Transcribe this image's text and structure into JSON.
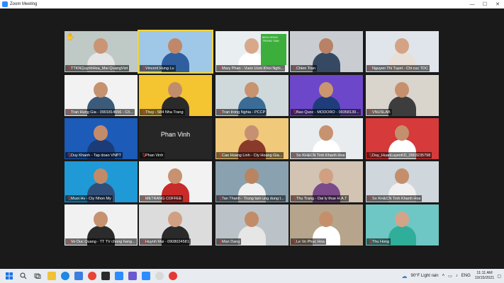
{
  "window": {
    "title": "Zoom Meeting",
    "minimize": "—",
    "maximize": "☐",
    "close": "✕"
  },
  "participants": [
    {
      "name": "TTKNQuynhHoa_Mai-QuangViet",
      "skin": "#c99575",
      "shirt": "#e6e6e6",
      "bg": "#bfc9c6"
    },
    {
      "name": "Vincent Hung Lu",
      "skin": "#c08868",
      "shirt": "#2f5f9e",
      "bg": "#9fc7e8",
      "active": true
    },
    {
      "name": "Mary Phan - Vuon Uom Khoi Nghi...",
      "skin": "#d7a98a",
      "shirt": "#ffffff",
      "bg": "#e9eef0",
      "sign": "MOU HOUV TRUNG TAM"
    },
    {
      "name": "Chien Tran",
      "skin": "#b98165",
      "shirt": "#354a62",
      "bg": "#c9cdd2"
    },
    {
      "name": "Nguyen Thi Tuyet - Chi cuc TDC",
      "skin": "#d4a385",
      "shirt": "#e8e0d8",
      "bg": "#dfe5ea"
    },
    {
      "name": "Tran Hung Gia - 0901814656 - Cô...",
      "skin": "#c7926f",
      "shirt": "#3c5a7a",
      "bg": "#f2f2f2"
    },
    {
      "name": "Thuy - 584 Nha Trang",
      "skin": "#c28d6b",
      "shirt": "#2a2a2a",
      "bg": "#f4c431"
    },
    {
      "name": "Tran trong Nghia - PCCP",
      "skin": "#c8936f",
      "shirt": "#3b6c95",
      "bg": "#cfd9db"
    },
    {
      "name": "Bao Quoc - MODORO - 09358139...",
      "skin": "#c9966f",
      "shirt": "#1f3d7a",
      "bg": "#6d47c9"
    },
    {
      "name": "VNUSLAB",
      "skin": "#c7906d",
      "shirt": "#3d3d3d",
      "bg": "#d9d4cc"
    },
    {
      "name": "Duy Khanh - Tap doan VNPT",
      "skin": "#c28c6a",
      "shirt": "#1b3c79",
      "bg": "#1c5bb7"
    },
    {
      "name": "Phan Vinh",
      "skin": "",
      "shirt": "",
      "bg": "#262626",
      "placeholder": "Phan Vinh"
    },
    {
      "name": "Cao Hoang Linh - Cty Hoang Gia...",
      "skin": "#c59172",
      "shirt": "#8a3a2a",
      "bg": "#f0c97a"
    },
    {
      "name": "So KH&CN Tinh Khanh Hoa",
      "skin": "#c7926f",
      "shirt": "#ffffff",
      "bg": "#e9ecef"
    },
    {
      "name": "Duy_HuanLuyenKD_0903235798",
      "skin": "#c48f6c",
      "shirt": "#ffffff",
      "bg": "#d63a3a"
    },
    {
      "name": "Muoi Hv - Cty Nhon My",
      "skin": "#c28b68",
      "shirt": "#2f4f7a",
      "bg": "#1f9ad6"
    },
    {
      "name": "METRANG COFFEE",
      "skin": "#c89270",
      "shirt": "#c92a2a",
      "bg": "#f2f2f2"
    },
    {
      "name": "Tan Thanh - Trung tam ung dung t...",
      "skin": "#b9845f",
      "shirt": "#f0f0f0",
      "bg": "#8aa1b0"
    },
    {
      "name": "Thu Trang - Dai ly thue H.A.T",
      "skin": "#d1a082",
      "shirt": "#7a4a8a",
      "bg": "#d2c3b3"
    },
    {
      "name": "So KH&CN Tinh Khanh Hoa",
      "skin": "#c48e6c",
      "shirt": "#f0f0f0",
      "bg": "#cfd6dc"
    },
    {
      "name": "Vo Duc Quang - TT TV chong hang...",
      "skin": "#c7926f",
      "shirt": "#2b2b2b",
      "bg": "#f1f1f1"
    },
    {
      "name": "Huynh Mai - 0908024581",
      "skin": "#d1a083",
      "shirt": "#2a2a2a",
      "bg": "#dcdcdc"
    },
    {
      "name": "Man Dang",
      "skin": "#c28c69",
      "shirt": "#e6e6e6",
      "bg": "#bcc3c8"
    },
    {
      "name": "Le Vo Phuc Hoa",
      "skin": "#c58f6c",
      "shirt": "#ffffff",
      "bg": "#b6a58c"
    },
    {
      "name": "Thu Hong",
      "skin": "#d4a489",
      "shirt": "#2fae9a",
      "bg": "#6ec7c4"
    }
  ],
  "taskbar": {
    "weather": "90°F  Light rain",
    "lang": "ENG",
    "time": "11:11 AM",
    "date": "10/15/2021"
  }
}
